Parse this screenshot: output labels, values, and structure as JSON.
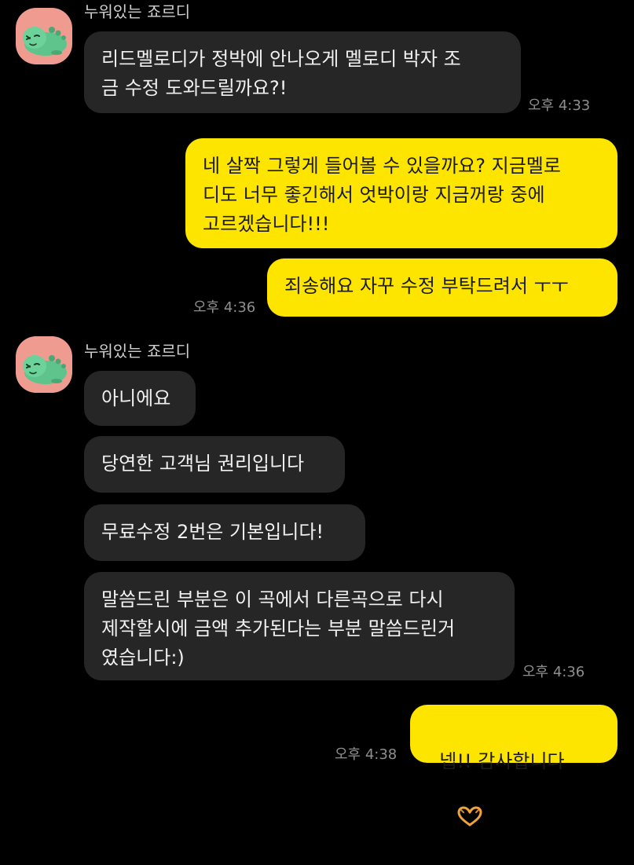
{
  "colors": {
    "background": "#000000",
    "incoming_bubble": "#262626",
    "outgoing_bubble": "#fee500",
    "avatar_bg": "#f09b8f"
  },
  "messages": [
    {
      "sender": "누워있는 죠르디",
      "text": "리드멜로디가 정박에 안나오게 멜로디 박자 조\n금 수정 도와드릴까요?!",
      "time": "오후 4:33"
    },
    {
      "text": "네 살짝 그렇게 들어볼 수 있을까요? 지금멜로\n디도 너무 좋긴해서 엇박이랑 지금꺼랑 중에\n고르겠습니다!!!"
    },
    {
      "text": "죄송해요 자꾸 수정 부탁드려서 ㅜㅜ",
      "time": "오후 4:36"
    },
    {
      "sender": "누워있는 죠르디",
      "text": "아니에요"
    },
    {
      "text": "당연한 고객님 권리입니다"
    },
    {
      "text": "무료수정 2번은 기본입니다!"
    },
    {
      "text": "말씀드린 부분은 이 곡에서 다른곡으로 다시\n제작할시에 금액 추가된다는 부분 말씀드린거\n였습니다:)",
      "time": "오후 4:36"
    },
    {
      "text": "넵!! 감사합니다",
      "icon": "heart-hands-icon",
      "time": "오후 4:38"
    }
  ]
}
